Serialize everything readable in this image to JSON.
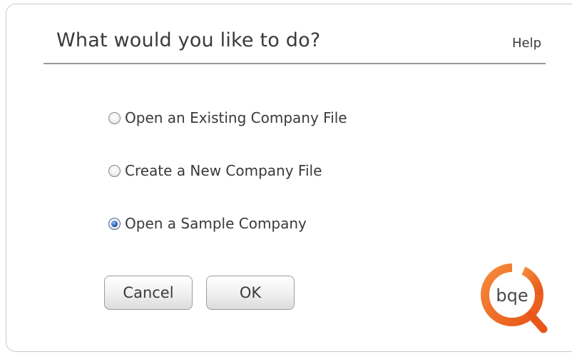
{
  "dialog": {
    "title": "What would you like to do?",
    "help_label": "Help"
  },
  "options": [
    {
      "label": "Open an Existing Company File",
      "selected": false
    },
    {
      "label": "Create a New Company File",
      "selected": false
    },
    {
      "label": "Open a Sample Company",
      "selected": true
    }
  ],
  "buttons": {
    "cancel_label": "Cancel",
    "ok_label": "OK"
  },
  "logo": {
    "text": "bqe",
    "icon": "bqe-logo-icon",
    "ring_color": "#f26b1d",
    "text_color": "#4a4a4a"
  },
  "colors": {
    "radio_selected": "#2a5fb8",
    "header_rule": "#9a9a9a",
    "text": "#3a3a3a"
  }
}
